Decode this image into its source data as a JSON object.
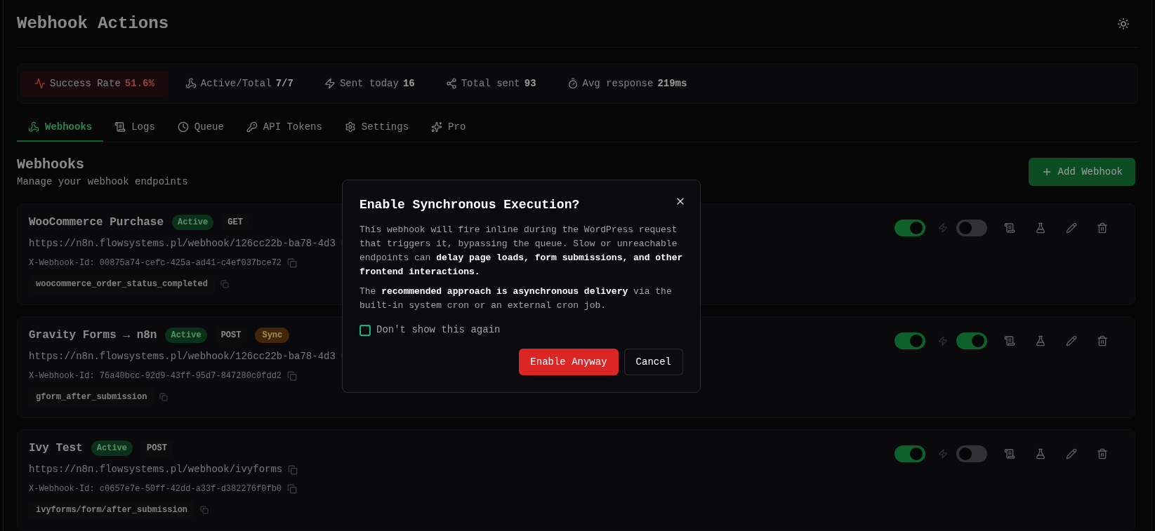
{
  "header": {
    "title": "Webhook Actions"
  },
  "stats": [
    {
      "label": "Success Rate",
      "value": "51.6%",
      "warning": true
    },
    {
      "label": "Active/Total",
      "value": "7/7",
      "warning": false
    },
    {
      "label": "Sent today",
      "value": "16",
      "warning": false
    },
    {
      "label": "Total sent",
      "value": "93",
      "warning": false
    },
    {
      "label": "Avg response",
      "value": "219ms",
      "warning": false
    }
  ],
  "tabs": [
    {
      "label": "Webhooks",
      "selected": true
    },
    {
      "label": "Logs",
      "selected": false
    },
    {
      "label": "Queue",
      "selected": false
    },
    {
      "label": "API Tokens",
      "selected": false
    },
    {
      "label": "Settings",
      "selected": false
    },
    {
      "label": "Pro",
      "selected": false
    }
  ],
  "section": {
    "title": "Webhooks",
    "subtitle": "Manage your webhook endpoints",
    "add_button": "Add Webhook"
  },
  "webhooks": [
    {
      "name": "WooCommerce Purchase",
      "status": "Active",
      "method": "GET",
      "url": "https://n8n.flowsystems.pl/webhook/126cc22b-ba78-4d3",
      "webhook_id": "X-Webhook-Id: 00875a74-cefc-425a-ad41-c4ef037bce72",
      "trigger": "woocommerce_order_status_completed",
      "enabled": true,
      "sync": false
    },
    {
      "name": "Gravity Forms → n8n",
      "status": "Active",
      "method": "POST",
      "sync_badge": "Sync",
      "url": "https://n8n.flowsystems.pl/webhook/126cc22b-ba78-4d3",
      "webhook_id": "X-Webhook-Id: 76a40bcc-92d9-43ff-95d7-847280c0fdd2",
      "trigger": "gform_after_submission",
      "enabled": true,
      "sync": true
    },
    {
      "name": "Ivy Test",
      "status": "Active",
      "method": "POST",
      "url": "https://n8n.flowsystems.pl/webhook/ivyforms",
      "webhook_id": "X-Webhook-Id: c0657e7e-50ff-42dd-a33f-d382276f0fb0",
      "trigger": "ivyforms/form/after_submission",
      "enabled": true,
      "sync": false
    }
  ],
  "dialog": {
    "title": "Enable Synchronous Execution?",
    "paragraphs": [
      "This webhook will fire inline during the WordPress request that triggers it, bypassing the queue. Slow or unreachable endpoints can **delay page loads, form submissions, and other frontend interactions.**",
      "The **recommended approach is asynchronous delivery** via the built-in system cron or an external cron job."
    ],
    "checkbox": {
      "label": "Don't show this again",
      "checked": false
    },
    "buttons": [
      {
        "label": "Enable Anyway",
        "kind": "danger"
      },
      {
        "label": "Cancel",
        "kind": "secondary"
      }
    ]
  }
}
